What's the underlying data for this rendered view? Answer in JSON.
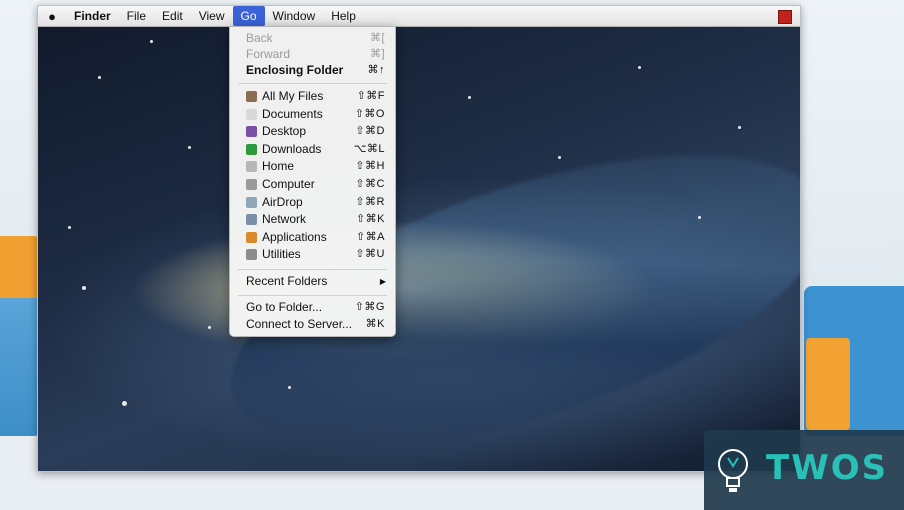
{
  "menubar": {
    "apple": "",
    "items": [
      {
        "label": "Finder"
      },
      {
        "label": "File"
      },
      {
        "label": "Edit"
      },
      {
        "label": "View"
      },
      {
        "label": "Go"
      },
      {
        "label": "Window"
      },
      {
        "label": "Help"
      }
    ]
  },
  "go_menu": {
    "back": {
      "label": "Back",
      "shortcut": "⌘["
    },
    "forward": {
      "label": "Forward",
      "shortcut": "⌘]"
    },
    "enclosing": {
      "label": "Enclosing Folder",
      "shortcut": "⌘↑"
    },
    "places": [
      {
        "label": "All My Files",
        "shortcut": "⇧⌘F",
        "icon": "all-my-files-icon",
        "color": "#8a6e52"
      },
      {
        "label": "Documents",
        "shortcut": "⇧⌘O",
        "icon": "documents-icon",
        "color": "#d8d8d8"
      },
      {
        "label": "Desktop",
        "shortcut": "⇧⌘D",
        "icon": "desktop-icon",
        "color": "#7a4fa8"
      },
      {
        "label": "Downloads",
        "shortcut": "⌥⌘L",
        "icon": "downloads-icon",
        "color": "#2e9a3c"
      },
      {
        "label": "Home",
        "shortcut": "⇧⌘H",
        "icon": "home-icon",
        "color": "#b7b7b7"
      },
      {
        "label": "Computer",
        "shortcut": "⇧⌘C",
        "icon": "computer-icon",
        "color": "#9a9a9a"
      },
      {
        "label": "AirDrop",
        "shortcut": "⇧⌘R",
        "icon": "airdrop-icon",
        "color": "#8fa6b8"
      },
      {
        "label": "Network",
        "shortcut": "⇧⌘K",
        "icon": "network-icon",
        "color": "#7d8fa6"
      },
      {
        "label": "Applications",
        "shortcut": "⇧⌘A",
        "icon": "applications-icon",
        "color": "#d98b2b"
      },
      {
        "label": "Utilities",
        "shortcut": "⇧⌘U",
        "icon": "utilities-icon",
        "color": "#8c8c8c"
      }
    ],
    "recent": {
      "label": "Recent Folders",
      "arrow": "▶"
    },
    "goto": {
      "label": "Go to Folder...",
      "shortcut": "⇧⌘G"
    },
    "connect": {
      "label": "Connect to Server...",
      "shortcut": "⌘K"
    }
  },
  "watermark": {
    "text": "TWOS",
    "color": "#29c0b8"
  }
}
